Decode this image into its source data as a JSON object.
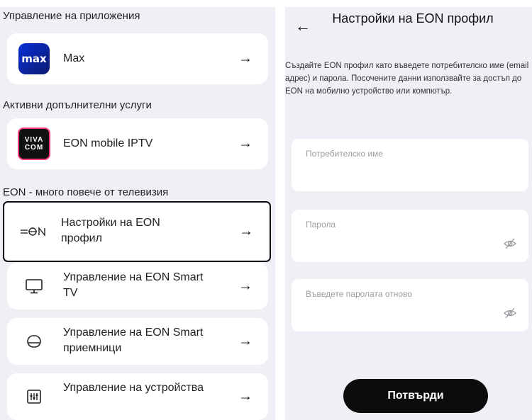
{
  "left": {
    "sections": [
      {
        "title": "Управление на приложения"
      },
      {
        "title": "Активни допълнителни услуги"
      },
      {
        "title": "EON - много повече от телевизия"
      }
    ],
    "cards": [
      {
        "label": "Max",
        "logo_text": "max",
        "icon": "max-logo"
      },
      {
        "label": "EON mobile IPTV",
        "logo_text": "VIVA COM",
        "icon": "vivacom-logo"
      },
      {
        "label": "Настройки на EON профил",
        "icon": "eon-logo-icon"
      },
      {
        "label": "Управление на EON Smart TV",
        "icon": "tv-icon"
      },
      {
        "label": "Управление на EON Smart приемници",
        "icon": "receiver-icon"
      },
      {
        "label": "Управление на устройства",
        "icon": "device-settings-icon"
      }
    ],
    "arrow": "→"
  },
  "right": {
    "back": "←",
    "title": "Настройки на EON профил",
    "intro": "Създайте EON профил като въведете потребителско име (email адрес) и парола. Посочените данни използвайте за достъп до EON на мобилно устройство или компютър.",
    "fields": {
      "username": "Потребителско име",
      "password": "Парола",
      "repeat": "Въведете паролата отново"
    },
    "confirm": "Потвърди"
  }
}
